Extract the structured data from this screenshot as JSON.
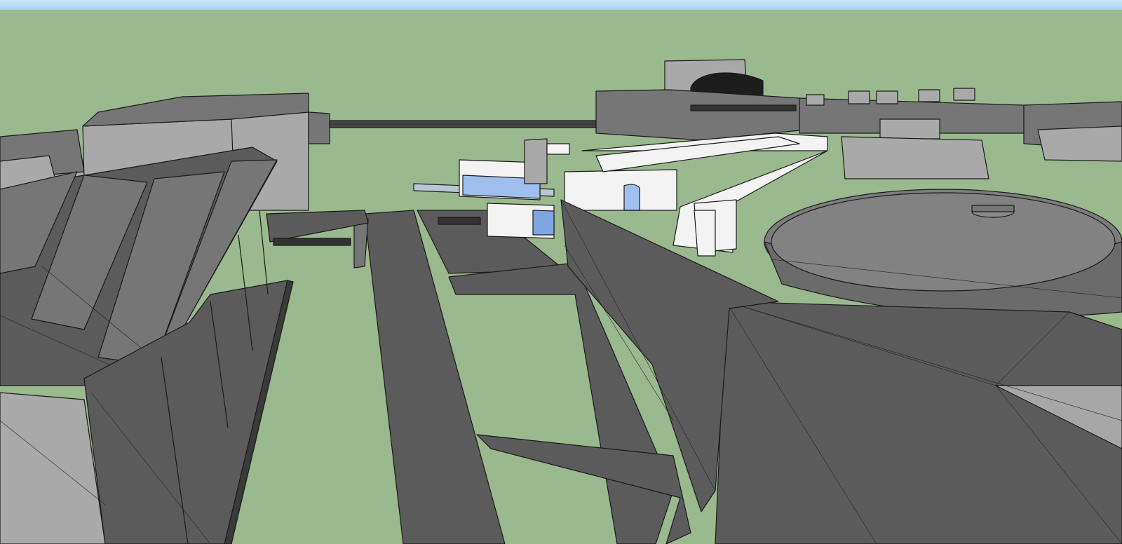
{
  "viewport": {
    "kind": "3d-model-view",
    "style": "hidden-line shaded, monochrome with highlighted building",
    "colors": {
      "sky_strip": "#a8d0f3",
      "ground": "#9ab98e",
      "terrain_dark": "#5b5b5b",
      "terrain_mid": "#767676",
      "building_grey": "#a9a9a9",
      "highlight_building": "#f3f3f3",
      "glazing": "#9fc0ef",
      "edges": "#1a1a1a"
    }
  }
}
